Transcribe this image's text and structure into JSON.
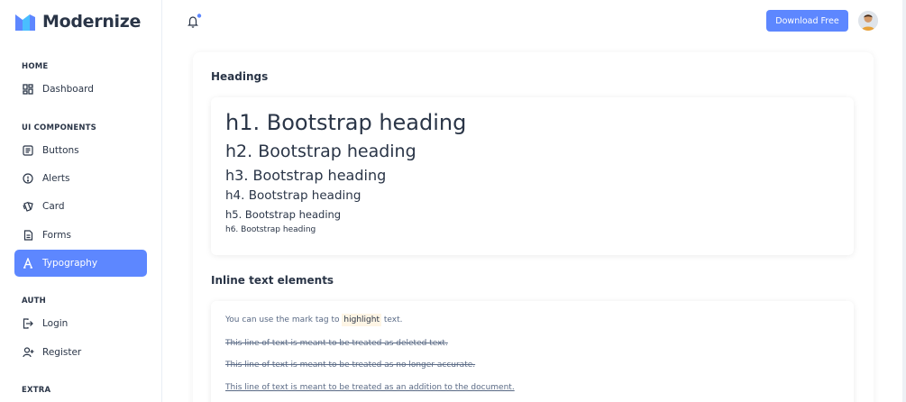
{
  "app": {
    "brand_name": "Modernize",
    "brand_colors": [
      "#5d87ff",
      "#49beff"
    ]
  },
  "sidebar": {
    "sections": [
      {
        "heading": "HOME",
        "items": [
          {
            "label": "Dashboard",
            "icon": "layout-dashboard-icon"
          }
        ]
      },
      {
        "heading": "UI COMPONENTS",
        "items": [
          {
            "label": "Buttons",
            "icon": "article-icon"
          },
          {
            "label": "Alerts",
            "icon": "alert-circle-icon"
          },
          {
            "label": "Card",
            "icon": "cards-icon"
          },
          {
            "label": "Forms",
            "icon": "file-description-icon"
          },
          {
            "label": "Typography",
            "icon": "typography-icon",
            "active": true
          }
        ]
      },
      {
        "heading": "AUTH",
        "items": [
          {
            "label": "Login",
            "icon": "login-icon"
          },
          {
            "label": "Register",
            "icon": "user-plus-icon"
          }
        ]
      },
      {
        "heading": "EXTRA",
        "items": []
      }
    ],
    "active_color": "#5d87ff"
  },
  "header": {
    "notification_icon": "bell-icon",
    "download_label": "Download Free",
    "avatar_icon": "user-avatar-icon"
  },
  "headings_section": {
    "title": "Headings",
    "h1": "h1. Bootstrap heading",
    "h2": "h2. Bootstrap heading",
    "h3": "h3. Bootstrap heading",
    "h4": "h4. Bootstrap heading",
    "h5": "h5. Bootstrap heading",
    "h6": "h6. Bootstrap heading"
  },
  "inline_section": {
    "title": "Inline text elements",
    "mark_prefix": "You can use the mark tag to ",
    "mark_word": "highlight",
    "mark_suffix": " text.",
    "deleted": "This line of text is meant to be treated as deleted text.",
    "strikethrough": "This line of text is meant to be treated as no longer accurate.",
    "inserted": "This line of text is meant to be treated as an addition to the document."
  }
}
